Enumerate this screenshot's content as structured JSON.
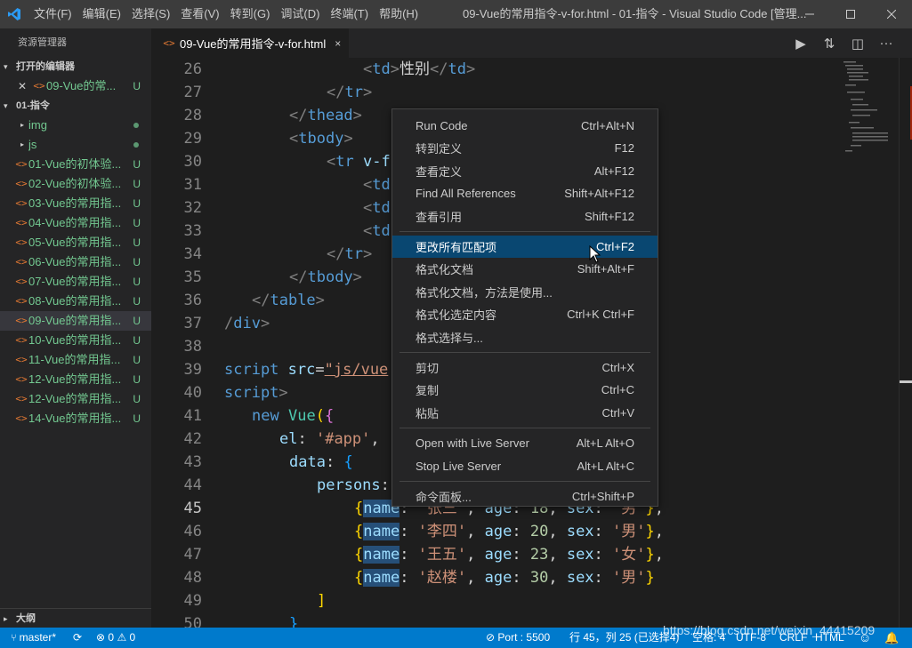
{
  "titlebar": {
    "menus": [
      "文件(F)",
      "编辑(E)",
      "选择(S)",
      "查看(V)",
      "转到(G)",
      "调试(D)",
      "终端(T)",
      "帮助(H)"
    ],
    "title": "09-Vue的常用指令-v-for.html - 01-指令 - Visual Studio Code [管理..."
  },
  "sidebar": {
    "title": "资源管理器",
    "open_editors_header": "打开的编辑器",
    "open_editor_item": {
      "label": "09-Vue的常...",
      "badge": "U"
    },
    "folder_header": "01-指令",
    "folders": [
      {
        "label": "img"
      },
      {
        "label": "js"
      }
    ],
    "files": [
      {
        "label": "01-Vue的初体验...",
        "badge": "U"
      },
      {
        "label": "02-Vue的初体验...",
        "badge": "U"
      },
      {
        "label": "03-Vue的常用指...",
        "badge": "U"
      },
      {
        "label": "04-Vue的常用指...",
        "badge": "U"
      },
      {
        "label": "05-Vue的常用指...",
        "badge": "U"
      },
      {
        "label": "06-Vue的常用指...",
        "badge": "U"
      },
      {
        "label": "07-Vue的常用指...",
        "badge": "U"
      },
      {
        "label": "08-Vue的常用指...",
        "badge": "U"
      },
      {
        "label": "09-Vue的常用指...",
        "badge": "U"
      },
      {
        "label": "10-Vue的常用指...",
        "badge": "U"
      },
      {
        "label": "11-Vue的常用指...",
        "badge": "U"
      },
      {
        "label": "12-Vue的常用指...",
        "badge": "U"
      },
      {
        "label": "12-Vue的常用指...",
        "badge": "U"
      },
      {
        "label": "14-Vue的常用指...",
        "badge": "U"
      }
    ],
    "outline_header": "大纲"
  },
  "tab": {
    "label": "09-Vue的常用指令-v-for.html",
    "close": "×"
  },
  "editor": {
    "line_numbers": [
      "26",
      "27",
      "28",
      "29",
      "30",
      "31",
      "32",
      "33",
      "34",
      "35",
      "36",
      "37",
      "38",
      "39",
      "40",
      "41",
      "42",
      "43",
      "44",
      "45",
      "46",
      "47",
      "48",
      "49",
      "50"
    ],
    "code_text": {
      "l26": "性别",
      "l30_attr": "v-f",
      "l39_a": "script",
      "l39_b": "src",
      "l39_c": "\"js/vue",
      "l40": "script",
      "l41_kw": "new",
      "l41_cls": "Vue",
      "l42_key": "el",
      "l42_val": "'#app'",
      "l43_key": "data",
      "l44_key": "persons",
      "name_key": "name",
      "age_key": "age",
      "sex_key": "sex",
      "p45_name": "'张三'",
      "p45_age": "18",
      "p45_sex": "'男'",
      "p46_name": "'李四'",
      "p46_age": "20",
      "p46_sex": "'男'",
      "p47_name": "'王五'",
      "p47_age": "23",
      "p47_sex": "'女'",
      "p48_name": "'赵楼'",
      "p48_age": "30",
      "p48_sex": "'男'"
    }
  },
  "context_menu": {
    "groups": [
      [
        {
          "label": "Run Code",
          "shortcut": "Ctrl+Alt+N"
        },
        {
          "label": "转到定义",
          "shortcut": "F12"
        },
        {
          "label": "查看定义",
          "shortcut": "Alt+F12"
        },
        {
          "label": "Find All References",
          "shortcut": "Shift+Alt+F12"
        },
        {
          "label": "查看引用",
          "shortcut": "Shift+F12"
        }
      ],
      [
        {
          "label": "更改所有匹配项",
          "shortcut": "Ctrl+F2",
          "active": true
        },
        {
          "label": "格式化文档",
          "shortcut": "Shift+Alt+F"
        },
        {
          "label": "格式化文档，方法是使用...",
          "shortcut": ""
        },
        {
          "label": "格式化选定内容",
          "shortcut": "Ctrl+K Ctrl+F"
        },
        {
          "label": "格式选择与...",
          "shortcut": ""
        }
      ],
      [
        {
          "label": "剪切",
          "shortcut": "Ctrl+X"
        },
        {
          "label": "复制",
          "shortcut": "Ctrl+C"
        },
        {
          "label": "粘贴",
          "shortcut": "Ctrl+V"
        }
      ],
      [
        {
          "label": "Open with Live Server",
          "shortcut": "Alt+L Alt+O"
        },
        {
          "label": "Stop Live Server",
          "shortcut": "Alt+L Alt+C"
        }
      ],
      [
        {
          "label": "命令面板...",
          "shortcut": "Ctrl+Shift+P"
        }
      ]
    ]
  },
  "statusbar": {
    "branch": "master*",
    "errors": "0",
    "warnings": "0",
    "port": "Port : 5500",
    "position": "行 45，列 25 (已选择4)",
    "spaces": "空格: 4",
    "encoding": "UTF-8",
    "eol": "CRLF",
    "language": "HTML"
  },
  "watermark": "https://blog.csdn.net/weixin_44415209",
  "colors": {
    "accent": "#007acc",
    "untracked": "#73c991",
    "menu_active": "#094771"
  }
}
